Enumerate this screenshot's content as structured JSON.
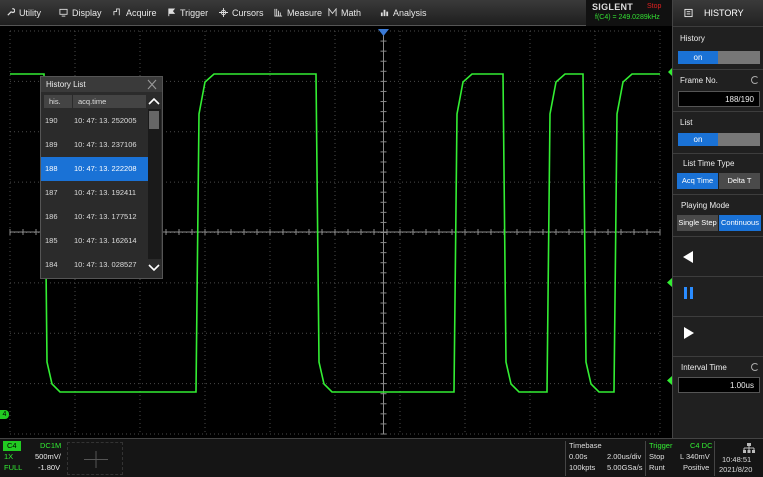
{
  "menu": {
    "items": [
      {
        "label": "Utility",
        "icon": "wrench-icon"
      },
      {
        "label": "Display",
        "icon": "monitor-icon"
      },
      {
        "label": "Acquire",
        "icon": "acquire-icon"
      },
      {
        "label": "Trigger",
        "icon": "flag-icon"
      },
      {
        "label": "Cursors",
        "icon": "cursor-icon"
      },
      {
        "label": "Measure",
        "icon": "ruler-icon"
      },
      {
        "label": "Math",
        "icon": "math-icon"
      },
      {
        "label": "Analysis",
        "icon": "chart-icon"
      }
    ]
  },
  "brand": {
    "logo": "SIGLENT",
    "status": "Stop",
    "frequency": "f(C4) = 249.0289kHz"
  },
  "side": {
    "header": "HISTORY",
    "history_label": "History",
    "history_on": "on",
    "frame_label": "Frame No.",
    "frame_value": "188/190",
    "list_label": "List",
    "list_on": "on",
    "list_time_type_label": "List Time Type",
    "acq_time": "Acq Time",
    "delta_t": "Delta T",
    "playing_mode_label": "Playing Mode",
    "single_step": "Single Step",
    "continuous": "Continuous",
    "interval_label": "Interval Time",
    "interval_value": "1.00us"
  },
  "history_list": {
    "title": "History List",
    "col_his": "his.",
    "col_time": "acq.time",
    "rows": [
      {
        "his": "190",
        "time": "10: 47: 13. 252005"
      },
      {
        "his": "189",
        "time": "10: 47: 13. 237106"
      },
      {
        "his": "188",
        "time": "10: 47: 13. 222208"
      },
      {
        "his": "187",
        "time": "10: 47: 13. 192411"
      },
      {
        "his": "186",
        "time": "10: 47: 13. 177512"
      },
      {
        "his": "185",
        "time": "10: 47: 13. 162614"
      },
      {
        "his": "184",
        "time": "10: 47: 13. 028527"
      }
    ],
    "selected": "188"
  },
  "channel": {
    "name": "C4",
    "coupling": "DC1M",
    "probe": "1X",
    "scale": "500mV/",
    "bw": "FULL",
    "offset": "-1.80V"
  },
  "timebase": {
    "label": "Timebase",
    "delay": "0.00s",
    "scale": "2.00us/div",
    "points": "100kpts",
    "rate": "5.00GSa/s"
  },
  "trigger": {
    "label": "Trigger",
    "source": "C4 DC",
    "state": "Stop",
    "level": "L 340mV",
    "mode": "Runt",
    "slope": "Positive"
  },
  "clock": {
    "time": "10:48:51",
    "date": "2021/8/20"
  },
  "channel_marker": "4",
  "colors": {
    "trace": "#33ee33",
    "accent": "#1a72d6",
    "stop": "#e02020",
    "channel": "#22cc22"
  }
}
